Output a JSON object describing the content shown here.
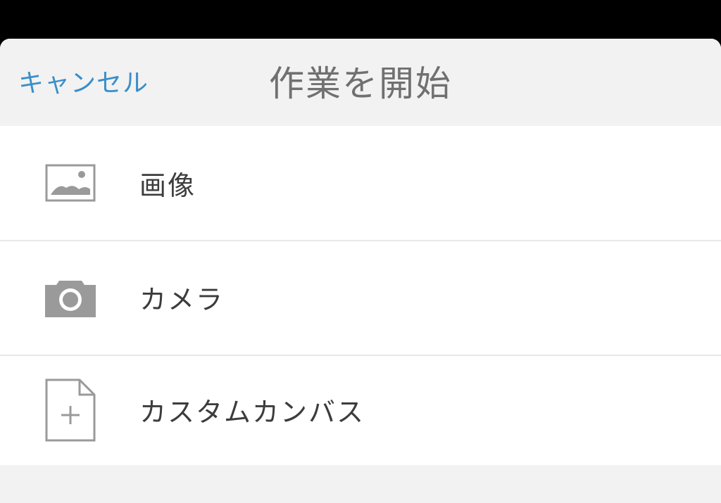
{
  "header": {
    "cancel_label": "キャンセル",
    "title": "作業を開始"
  },
  "menu": {
    "items": [
      {
        "label": "画像",
        "icon": "image-icon"
      },
      {
        "label": "カメラ",
        "icon": "camera-icon"
      },
      {
        "label": "カスタムカンバス",
        "icon": "new-document-icon"
      }
    ]
  },
  "colors": {
    "accent": "#3a8fc8",
    "title": "#707070",
    "label": "#3c3c3c",
    "icon": "#9a9a9a",
    "sheet_bg": "#f2f2f2",
    "list_bg": "#ffffff",
    "divider": "#e8e8e8"
  }
}
